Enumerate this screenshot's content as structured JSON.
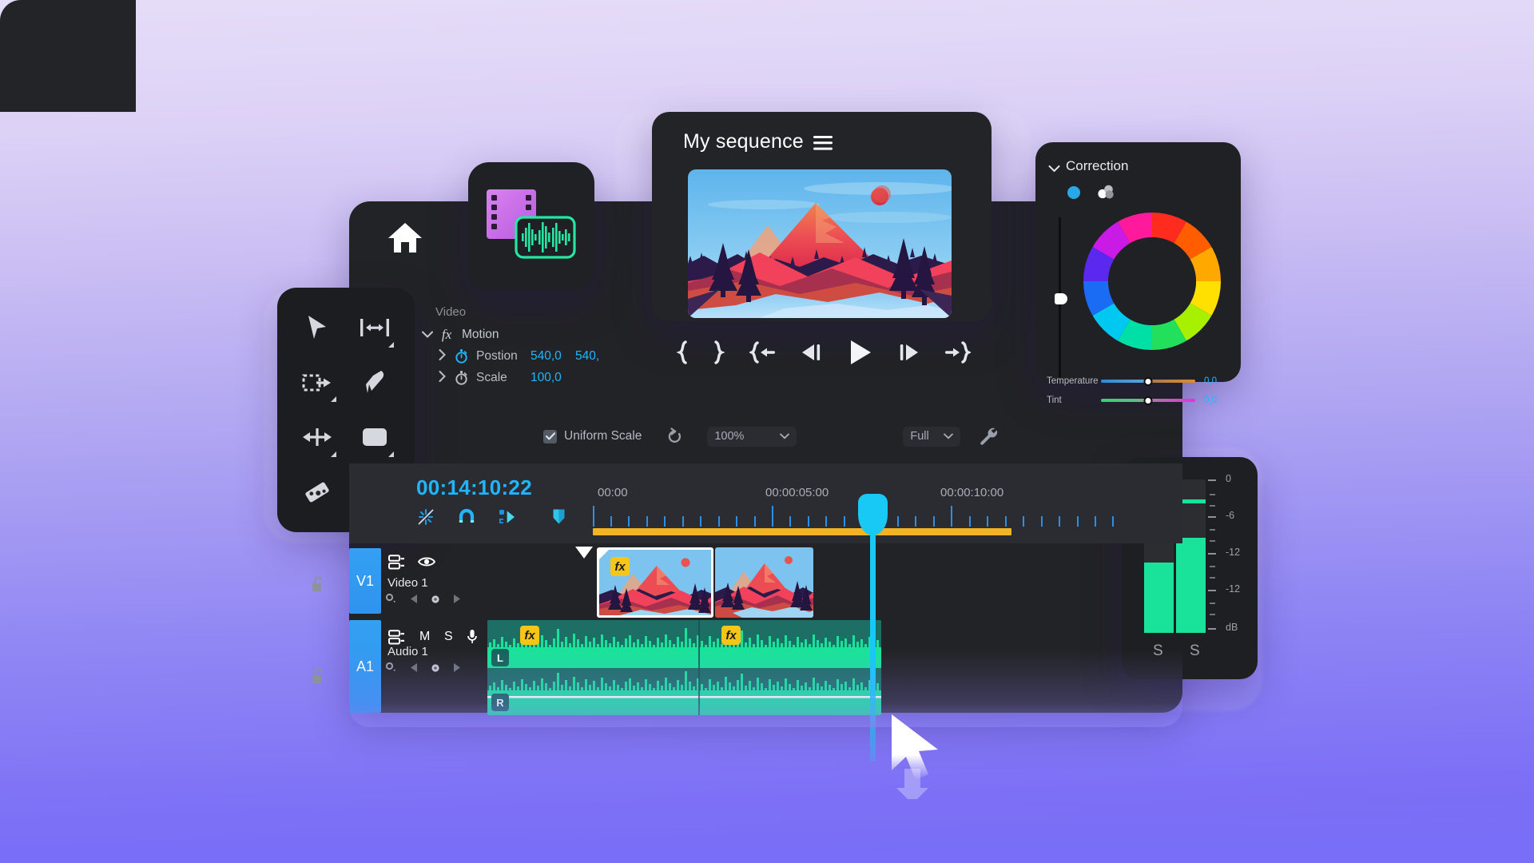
{
  "app": {
    "background_gradient_top": "#e6ddf8",
    "background_gradient_bottom": "#7468f7"
  },
  "home": {
    "icon": "home-icon"
  },
  "media_card": {
    "film_icon": "film-strip-icon",
    "audio_icon": "audio-waveform-icon",
    "film_color": "#cf73e8",
    "audio_color": "#27e6a4"
  },
  "tools": {
    "items": [
      {
        "name": "selection-tool",
        "icon": "arrow-cursor-icon",
        "has_flyout": false
      },
      {
        "name": "track-select-tool",
        "icon": "horizontal-resize-icon",
        "has_flyout": true
      },
      {
        "name": "ripple-edit-tool",
        "icon": "ripple-edit-icon",
        "has_flyout": true
      },
      {
        "name": "pen-tool",
        "icon": "pen-icon",
        "has_flyout": false
      },
      {
        "name": "slip-tool",
        "icon": "slip-arrows-icon",
        "has_flyout": true
      },
      {
        "name": "rectangle-tool",
        "icon": "rounded-rectangle-icon",
        "has_flyout": true
      },
      {
        "name": "razor-tool",
        "icon": "razor-blade-icon",
        "has_flyout": false
      },
      {
        "name": "hand-tool",
        "icon": "hand-icon",
        "has_flyout": true
      }
    ]
  },
  "effect_controls": {
    "section_label": "Video",
    "group": {
      "label": "Motion",
      "fx_badge": "fx",
      "expanded": true,
      "chevron": "chevron-down-icon"
    },
    "properties": [
      {
        "label": "Postion",
        "values": [
          "540,0",
          "540,"
        ],
        "stopwatch": "stopwatch-icon",
        "stopwatch_active": true,
        "chevron": "chevron-right-icon"
      },
      {
        "label": "Scale",
        "values": [
          "100,0"
        ],
        "stopwatch": "stopwatch-icon",
        "stopwatch_active": false,
        "chevron": "chevron-right-icon"
      }
    ],
    "accent_value_color": "#1fb6ff"
  },
  "settings_strip": {
    "uniform_scale": {
      "label": "Uniform Scale",
      "checked": true
    },
    "reset_button": "reset-icon",
    "zoom_level": {
      "value": "100%",
      "chevron": "chevron-down-icon"
    },
    "quality": {
      "value": "Full",
      "chevron": "chevron-down-icon"
    },
    "wrench_button": "wrench-icon"
  },
  "monitor": {
    "title": "My sequence",
    "menu_icon": "hamburger-menu-icon",
    "transport": [
      {
        "name": "mark-in-button",
        "icon": "brace-left-icon"
      },
      {
        "name": "mark-out-button",
        "icon": "brace-right-icon"
      },
      {
        "name": "go-to-in-button",
        "icon": "go-to-in-icon"
      },
      {
        "name": "step-back-button",
        "icon": "step-back-icon"
      },
      {
        "name": "play-button",
        "icon": "play-icon"
      },
      {
        "name": "step-forward-button",
        "icon": "step-forward-icon"
      },
      {
        "name": "go-to-out-button",
        "icon": "go-to-out-icon"
      }
    ]
  },
  "correction": {
    "title": "Correction",
    "collapse_chevron": "chevron-down-icon",
    "tabs": [
      {
        "name": "color-wheel-tab",
        "icon": "circle-dot-icon",
        "active": true,
        "color": "#28a8e8"
      },
      {
        "name": "curves-tab",
        "icon": "three-dots-icon",
        "active": false,
        "color": "#d7dade"
      }
    ],
    "luma_slider": {
      "name": "luma-slider",
      "value": 0.5
    },
    "color_wheel": {
      "name": "color-wheel"
    },
    "sliders": [
      {
        "label": "Temperature",
        "value": "0,0",
        "left_color": "#2f8bd6",
        "right_color": "#e08a2a"
      },
      {
        "label": "Tint",
        "value": "0,0",
        "left_color": "#2fd66e",
        "right_color": "#ea2fd6"
      }
    ],
    "value_color": "#1fb6ff"
  },
  "audio_meters": {
    "scale_labels": [
      "0",
      "-6",
      "-12",
      "-12",
      "dB"
    ],
    "channels": [
      {
        "name": "left-channel-meter",
        "solo_label": "S",
        "level_pct": 46,
        "peak_pct": 88
      },
      {
        "name": "right-channel-meter",
        "solo_label": "S",
        "level_pct": 62,
        "peak_pct": 88
      }
    ],
    "meter_color": "#19e39a"
  },
  "timeline": {
    "timecode": "00:14:10:22",
    "timecode_color": "#1fb6ff",
    "tools": [
      {
        "name": "timeline-snap-toggle",
        "icon": "snap-magnet-sparkle-icon",
        "active": true
      },
      {
        "name": "magnet-snap-toggle",
        "icon": "magnet-icon",
        "active": true
      },
      {
        "name": "linked-selection-toggle",
        "icon": "linked-selection-icon",
        "active": true
      },
      {
        "name": "marker-button",
        "icon": "marker-shield-icon",
        "active": true
      }
    ],
    "ruler_labels": [
      "00:00",
      "00:00:05:00",
      "00:00:10:00"
    ],
    "work_area_color": "#f2b424",
    "playhead_color": "#18c8f5",
    "tracks": [
      {
        "id": "V1",
        "name": "Video 1",
        "lock_icon": "unlock-icon",
        "buttons": [
          {
            "name": "track-targeting-v1",
            "icon": "track-target-icon"
          },
          {
            "name": "track-visibility-v1",
            "icon": "eye-icon"
          }
        ],
        "keyframe_nav": [
          "keyframe-options-icon",
          "prev-keyframe-icon",
          "add-keyframe-icon",
          "next-keyframe-icon"
        ],
        "clips": [
          {
            "name": "video-clip-1",
            "fx_badge": "fx",
            "selected": true
          },
          {
            "name": "video-clip-2",
            "fx_badge": "",
            "selected": false
          }
        ]
      },
      {
        "id": "A1",
        "name": "Audio 1",
        "lock_icon": "unlock-icon",
        "buttons": [
          {
            "name": "track-targeting-a1",
            "icon": "track-target-icon"
          },
          {
            "name": "mute-track-a1",
            "icon": "M"
          },
          {
            "name": "solo-track-a1",
            "icon": "S"
          },
          {
            "name": "voiceover-record-a1",
            "icon": "microphone-icon"
          }
        ],
        "keyframe_nav": [
          "keyframe-options-icon",
          "prev-keyframe-icon",
          "add-keyframe-icon",
          "next-keyframe-icon"
        ],
        "clip": {
          "name": "audio-clip-1",
          "fx_badges": [
            "fx",
            "fx"
          ],
          "channel_labels": [
            "L",
            "R"
          ],
          "waveform_color": "#19e39a",
          "clip_color": "#1d6f66"
        }
      }
    ]
  },
  "cursor": {
    "name": "mouse-pointer"
  }
}
